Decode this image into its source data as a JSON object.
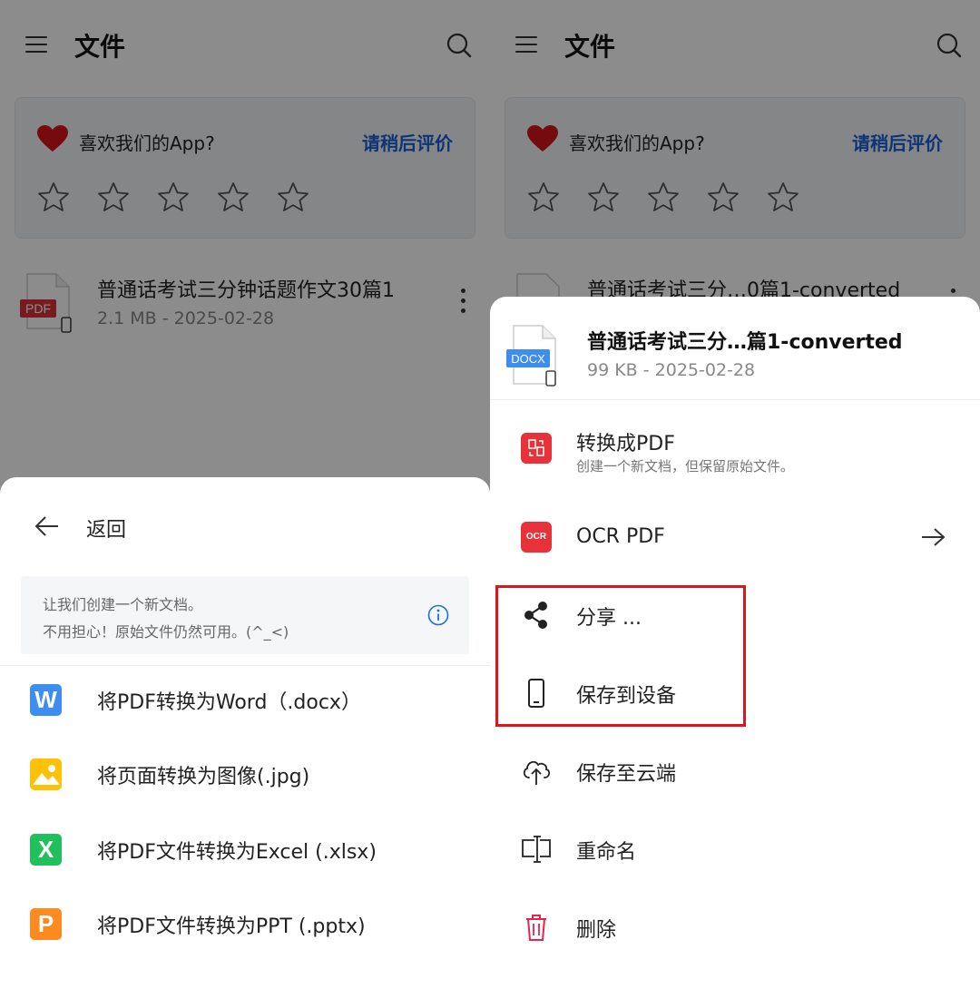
{
  "app": {
    "title": "文件",
    "rating": {
      "title": "喜欢我们的App?",
      "action": "请稍后评价",
      "stars": 5
    }
  },
  "left": {
    "file": {
      "name": "普通话考试三分钟话题作文30篇1",
      "meta": "2.1 MB - 2025-02-28",
      "badge": "PDF"
    },
    "sheet": {
      "back_label": "返回",
      "info_line1": "让我们创建一个新文档。",
      "info_line2": "不用担心！原始文件仍然可用。(^_<)",
      "items": [
        {
          "badge": "W",
          "color": "#3d8ef0",
          "label": "将PDF转换为Word（.docx）"
        },
        {
          "badge": "",
          "color": "#ffc107",
          "label": "将页面转换为图像(.jpg)"
        },
        {
          "badge": "X",
          "color": "#20c05c",
          "label": "将PDF文件转换为Excel (.xlsx)"
        },
        {
          "badge": "P",
          "color": "#ff8a1f",
          "label": "将PDF文件转换为PPT (.pptx)"
        }
      ]
    }
  },
  "right": {
    "file": {
      "name": "普通话考试三分…0篇1-converted",
      "meta": "99 KB - 2025-02-28"
    },
    "sheet": {
      "file_name": "普通话考试三分…篇1-converted",
      "file_meta": "99 KB - 2025-02-28",
      "badge": "DOCX",
      "actions": [
        {
          "label": "转换成PDF",
          "sub": "创建一个新文档，但保留原始文件。"
        },
        {
          "label": "OCR PDF",
          "badge": "OCR"
        },
        {
          "label": "分享 ..."
        },
        {
          "label": "保存到设备"
        },
        {
          "label": "保存至云端"
        },
        {
          "label": "重命名"
        },
        {
          "label": "删除"
        }
      ]
    }
  },
  "colors": {
    "accent_blue": "#1a5fd6",
    "danger_red": "#e8323a",
    "highlight": "#e0141c"
  }
}
